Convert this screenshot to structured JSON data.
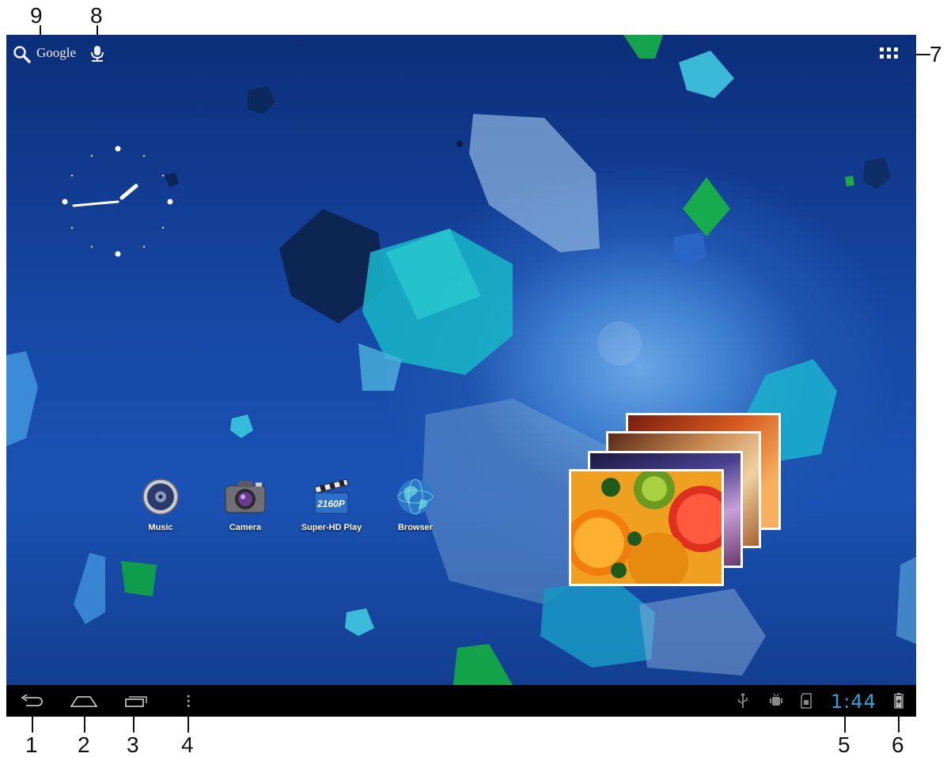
{
  "callouts": [
    "1",
    "2",
    "3",
    "4",
    "5",
    "6",
    "7",
    "8",
    "9"
  ],
  "search": {
    "label": "Google"
  },
  "apps": [
    {
      "label": "Music",
      "icon": "speaker-icon"
    },
    {
      "label": "Camera",
      "icon": "camera-icon"
    },
    {
      "label": "Super-HD Play",
      "icon": "clapperboard-icon",
      "badge": "2160P"
    },
    {
      "label": "Browser",
      "icon": "globe-icon"
    }
  ],
  "status": {
    "time": "1:44",
    "time_color": "#2aa2d8"
  },
  "colors": {
    "navbar": "#000000",
    "wallpaper": "#1a52b4"
  }
}
